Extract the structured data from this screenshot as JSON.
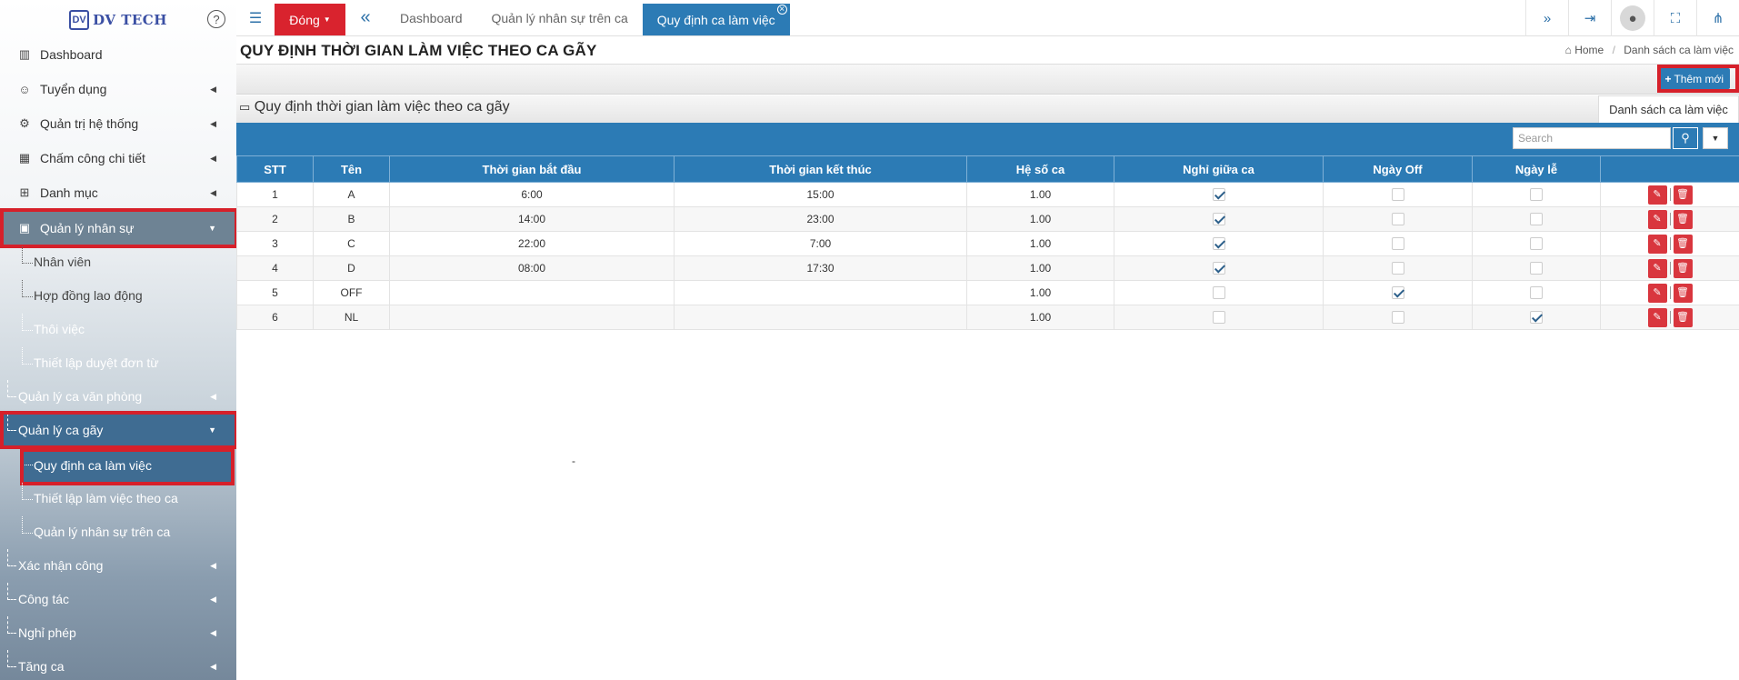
{
  "brand": {
    "logo_text": "DV TECH",
    "help_icon": "?"
  },
  "sidebar": {
    "items": [
      {
        "label": "Dashboard",
        "icon": "bar-chart-icon"
      },
      {
        "label": "Tuyển dụng",
        "icon": "user-icon"
      },
      {
        "label": "Quản trị hệ thống",
        "icon": "gear-icon"
      },
      {
        "label": "Chấm công chi tiết",
        "icon": "calendar-icon"
      },
      {
        "label": "Danh mục",
        "icon": "sitemap-icon"
      },
      {
        "label": "Quản lý nhân sự",
        "icon": "id-card-icon"
      }
    ],
    "hr_sub": [
      "Nhân viên",
      "Hợp đồng lao động",
      "Thôi việc",
      "Thiết lập duyệt đơn từ"
    ],
    "office_shift": "Quản lý ca văn phòng",
    "broken_shift": "Quản lý ca gãy",
    "broken_sub": [
      "Quy định ca làm việc",
      "Thiết lập làm việc theo ca",
      "Quản lý nhân sự trên ca"
    ],
    "bottom": [
      "Xác nhận công",
      "Công tác",
      "Nghỉ phép",
      "Tăng ca"
    ]
  },
  "topbar": {
    "close_label": "Đóng",
    "tabs": [
      "Dashboard",
      "Quản lý nhân sự trên ca",
      "Quy định ca làm việc"
    ]
  },
  "page": {
    "title": "QUY ĐỊNH THỜI GIAN LÀM VIỆC THEO CA GÃY",
    "breadcrumb_home": "Home",
    "breadcrumb_current": "Danh sách ca làm việc",
    "add_button": "Thêm mới",
    "panel_title": "Quy định thời gian làm việc theo ca gãy",
    "panel_tab": "Danh sách ca làm việc",
    "search_placeholder": "Search",
    "stray_text": "-"
  },
  "table": {
    "headers": [
      "STT",
      "Tên",
      "Thời gian bắt đầu",
      "Thời gian kết thúc",
      "Hệ số ca",
      "Nghỉ giữa ca",
      "Ngày Off",
      "Ngày lễ",
      ""
    ],
    "rows": [
      {
        "stt": "1",
        "ten": "A",
        "start": "6:00",
        "end": "15:00",
        "heso": "1.00",
        "nghi": true,
        "off": false,
        "le": false
      },
      {
        "stt": "2",
        "ten": "B",
        "start": "14:00",
        "end": "23:00",
        "heso": "1.00",
        "nghi": true,
        "off": false,
        "le": false
      },
      {
        "stt": "3",
        "ten": "C",
        "start": "22:00",
        "end": "7:00",
        "heso": "1.00",
        "nghi": true,
        "off": false,
        "le": false
      },
      {
        "stt": "4",
        "ten": "D",
        "start": "08:00",
        "end": "17:30",
        "heso": "1.00",
        "nghi": true,
        "off": false,
        "le": false
      },
      {
        "stt": "5",
        "ten": "OFF",
        "start": "",
        "end": "",
        "heso": "1.00",
        "nghi": false,
        "off": true,
        "le": false
      },
      {
        "stt": "6",
        "ten": "NL",
        "start": "",
        "end": "",
        "heso": "1.00",
        "nghi": false,
        "off": false,
        "le": true
      }
    ]
  },
  "colors": {
    "primary": "#2c7bb5",
    "danger": "#d9232e",
    "highlight_box": "#d6202a"
  }
}
